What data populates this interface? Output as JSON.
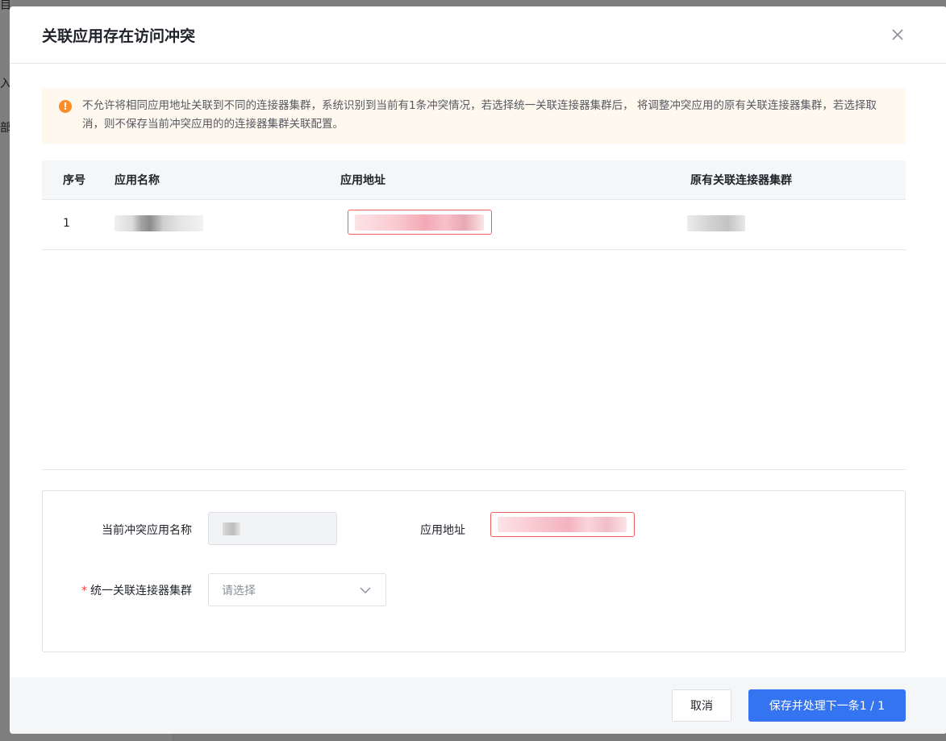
{
  "background": {
    "glyphs": [
      "目",
      "入",
      "部"
    ]
  },
  "dialog": {
    "title": "关联应用存在访问冲突",
    "alert_text": "不允许将相同应用地址关联到不同的连接器集群，系统识别到当前有1条冲突情况，若选择统一关联连接器集群后， 将调整冲突应用的原有关联连接器集群，若选择取消，则不保存当前冲突应用的的连接器集群关联配置。",
    "alert_icon": "!",
    "colors": {
      "primary": "#3574f0",
      "warning": "#fa8c2a",
      "required": "#f53f3f",
      "redacted_border": "#f06060"
    }
  },
  "table": {
    "columns": [
      "序号",
      "应用名称",
      "应用地址",
      "原有关联连接器集群"
    ],
    "rows": [
      {
        "index": "1"
      }
    ]
  },
  "form": {
    "app_name_label": "当前冲突应用名称",
    "app_addr_label": "应用地址",
    "required_mark": "*",
    "cluster_label": "统一关联连接器集群",
    "cluster_placeholder": "请选择"
  },
  "footer": {
    "cancel_label": "取消",
    "primary_label": "保存并处理下一条1 / 1"
  }
}
